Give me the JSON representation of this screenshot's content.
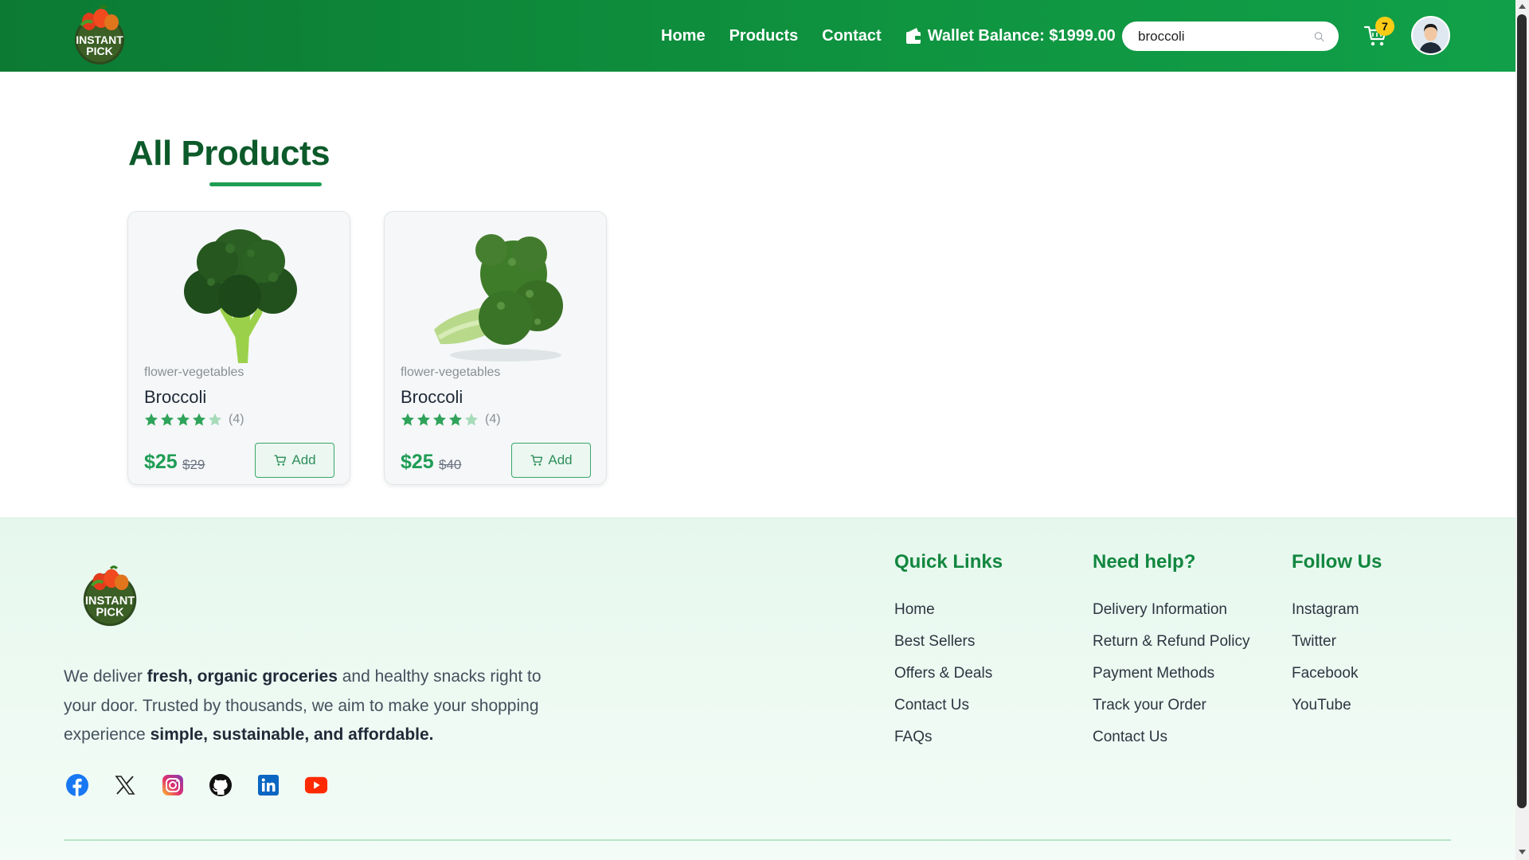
{
  "brand": {
    "logo_text_line1": "INSTANT",
    "logo_text_line2": "PICK"
  },
  "header": {
    "nav": [
      "Home",
      "Products",
      "Contact"
    ],
    "wallet_label": "Wallet Balance: $1999.00",
    "search_value": "broccoli",
    "cart_count": "7"
  },
  "main": {
    "title": "All Products",
    "products": [
      {
        "category": "flower-vegetables",
        "name": "Broccoli",
        "rating": 4,
        "rating_count": "(4)",
        "price": "$25",
        "old_price": "$29",
        "add_label": "Add"
      },
      {
        "category": "flower-vegetables",
        "name": "Broccoli",
        "rating": 4,
        "rating_count": "(4)",
        "price": "$25",
        "old_price": "$40",
        "add_label": "Add"
      }
    ]
  },
  "footer": {
    "desc_1": "We deliver ",
    "desc_b1": "fresh, organic groceries",
    "desc_2": " and healthy snacks right to your door. Trusted by thousands, we aim to make your shopping experience ",
    "desc_b2": "simple, sustainable, and affordable.",
    "socials": [
      "facebook-icon",
      "x-icon",
      "instagram-icon",
      "github-icon",
      "linkedin-icon",
      "youtube-icon"
    ],
    "columns": [
      {
        "title": "Quick Links",
        "links": [
          "Home",
          "Best Sellers",
          "Offers & Deals",
          "Contact Us",
          "FAQs"
        ]
      },
      {
        "title": "Need help?",
        "links": [
          "Delivery Information",
          "Return & Refund Policy",
          "Payment Methods",
          "Track your Order",
          "Contact Us"
        ]
      },
      {
        "title": "Follow Us",
        "links": [
          "Instagram",
          "Twitter",
          "Facebook",
          "YouTube"
        ]
      }
    ]
  },
  "colors": {
    "header": "#0f9440",
    "accent": "#1f9d55",
    "title": "#0c5a2a",
    "footer_bg": "#eaf9f0",
    "badge": "#facc15"
  }
}
